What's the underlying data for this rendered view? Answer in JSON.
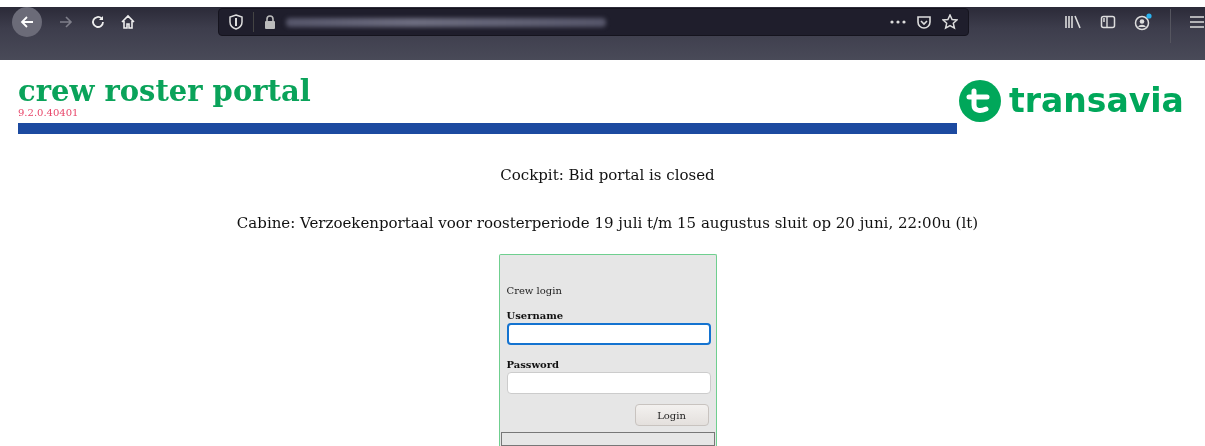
{
  "browser": {
    "back_enabled": true,
    "forward_enabled": false,
    "account_badge": true
  },
  "header": {
    "title": "crew roster portal",
    "version": "9.2.0.40401",
    "brand": "transavia"
  },
  "notices": [
    "Cockpit: Bid portal is closed",
    "Cabine: Verzoekenportaal voor roosterperiode 19 juli t/m 15 augustus sluit op 20 juni, 22:00u (lt)"
  ],
  "login": {
    "heading": "Crew login",
    "fields": [
      {
        "label": "Username",
        "focused": true
      },
      {
        "label": "Password",
        "focused": false
      }
    ],
    "button": "Login"
  }
}
